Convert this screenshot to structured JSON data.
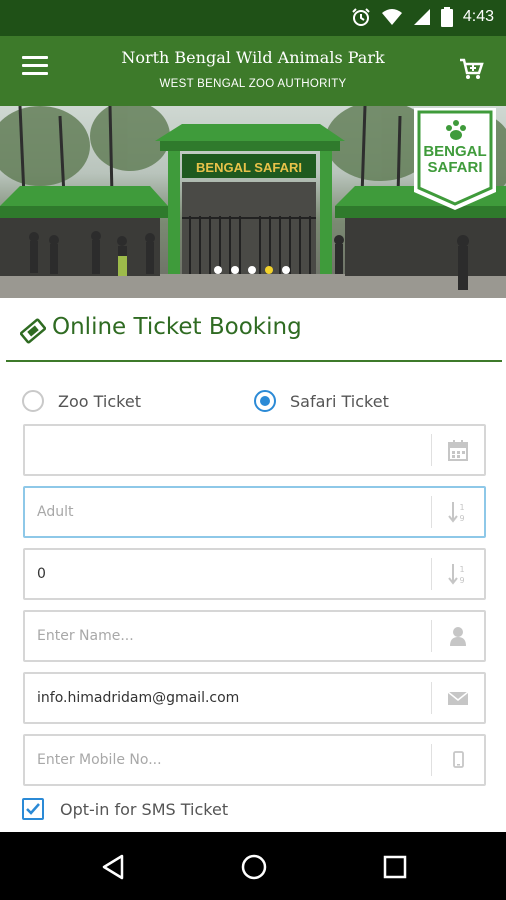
{
  "status_bar": {
    "time": "4:43",
    "icons": [
      "alarm-icon",
      "wifi-icon",
      "signal-icon",
      "battery-icon"
    ]
  },
  "app_bar": {
    "title": "North Bengal Wild Animals Park",
    "subtitle": "WEST BENGAL ZOO AUTHORITY",
    "menu_icon": "hamburger-icon",
    "cart_icon": "cart-icon"
  },
  "hero": {
    "gate_sign": "BENGAL SAFARI",
    "badge_line1": "BENGAL",
    "badge_line2": "SAFARI",
    "slide_count": 5,
    "active_slide": 4
  },
  "booking": {
    "title": "Online Ticket Booking",
    "title_icon": "ticket-icon",
    "ticket_types": [
      {
        "label": "Zoo Ticket",
        "selected": false
      },
      {
        "label": "Safari Ticket",
        "selected": true
      }
    ],
    "fields": {
      "date": {
        "value": "",
        "placeholder": "",
        "icon": "calendar-icon"
      },
      "visitor_type": {
        "value": "",
        "placeholder": "Adult",
        "icon": "sort-numeric-icon"
      },
      "count": {
        "value": "0",
        "placeholder": "",
        "icon": "sort-numeric-icon"
      },
      "name": {
        "value": "",
        "placeholder": "Enter Name...",
        "icon": "user-icon"
      },
      "email": {
        "value": "info.himadridam@gmail.com",
        "placeholder": "",
        "icon": "envelope-icon"
      },
      "mobile": {
        "value": "",
        "placeholder": "Enter Mobile No...",
        "icon": "mobile-icon"
      }
    },
    "sms_optin": {
      "label": "Opt-in for SMS Ticket",
      "checked": true
    }
  },
  "colors": {
    "status_bar": "#1f5117",
    "app_bar": "#3d7a2a",
    "accent_green": "#2f6b22",
    "radio_blue": "#2b8ad6",
    "active_dot": "#f2d22c"
  },
  "nav_bar": {
    "buttons": [
      "back-icon",
      "home-icon",
      "recents-icon"
    ]
  }
}
